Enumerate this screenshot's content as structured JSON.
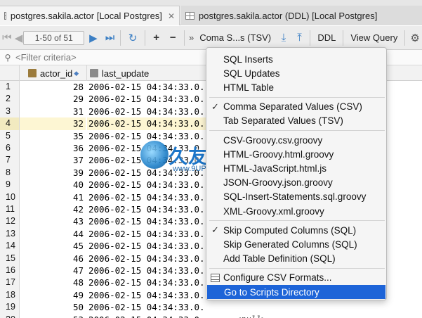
{
  "tabs": [
    {
      "label": "postgres.sakila.actor [Local Postgres]",
      "active": true
    },
    {
      "label": "postgres.sakila.actor (DDL) [Local Postgres]",
      "active": false
    }
  ],
  "toolbar": {
    "pager": "1-50 of 51",
    "export_label": "Coma S...s (TSV)",
    "ddl_label": "DDL",
    "view_query_label": "View Query",
    "more_label": "»"
  },
  "filter": {
    "placeholder": "<Filter criteria>"
  },
  "grid": {
    "columns": [
      "actor_id",
      "last_update"
    ],
    "rows": [
      {
        "num": "1",
        "id": "28",
        "upd": "2006-02-15 04:34:33.0..."
      },
      {
        "num": "2",
        "id": "29",
        "upd": "2006-02-15 04:34:33.0..."
      },
      {
        "num": "3",
        "id": "31",
        "upd": "2006-02-15 04:34:33.0..."
      },
      {
        "num": "4",
        "id": "32",
        "upd": "2006-02-15 04:34:33.0..."
      },
      {
        "num": "5",
        "id": "35",
        "upd": "2006-02-15 04:34:33.0..."
      },
      {
        "num": "6",
        "id": "36",
        "upd": "2006-02-15 04:34:33.0..."
      },
      {
        "num": "7",
        "id": "37",
        "upd": "2006-02-15 04:34:33.0..."
      },
      {
        "num": "8",
        "id": "39",
        "upd": "2006-02-15 04:34:33.0..."
      },
      {
        "num": "9",
        "id": "40",
        "upd": "2006-02-15 04:34:33.0..."
      },
      {
        "num": "10",
        "id": "41",
        "upd": "2006-02-15 04:34:33.0..."
      },
      {
        "num": "11",
        "id": "42",
        "upd": "2006-02-15 04:34:33.0..."
      },
      {
        "num": "12",
        "id": "43",
        "upd": "2006-02-15 04:34:33.0..."
      },
      {
        "num": "13",
        "id": "44",
        "upd": "2006-02-15 04:34:33.0..."
      },
      {
        "num": "14",
        "id": "45",
        "upd": "2006-02-15 04:34:33.0..."
      },
      {
        "num": "15",
        "id": "46",
        "upd": "2006-02-15 04:34:33.0..."
      },
      {
        "num": "16",
        "id": "47",
        "upd": "2006-02-15 04:34:33.0..."
      },
      {
        "num": "17",
        "id": "48",
        "upd": "2006-02-15 04:34:33.0..."
      },
      {
        "num": "18",
        "id": "49",
        "upd": "2006-02-15 04:34:33.0..."
      },
      {
        "num": "19",
        "id": "50",
        "upd": "2006-02-15 04:34:33.0..."
      },
      {
        "num": "20",
        "id": "53",
        "upd": "2006-02-15 04:34:33.0..."
      }
    ],
    "null_text": "<null>"
  },
  "menu": {
    "items": [
      {
        "label": "SQL Inserts",
        "checked": false
      },
      {
        "label": "SQL Updates",
        "checked": false
      },
      {
        "label": "HTML Table",
        "checked": false
      },
      {
        "separator": true
      },
      {
        "label": "Comma Separated Values (CSV)",
        "checked": true
      },
      {
        "label": "Tab Separated Values (TSV)",
        "checked": false
      },
      {
        "separator": true
      },
      {
        "label": "CSV-Groovy.csv.groovy",
        "checked": false
      },
      {
        "label": "HTML-Groovy.html.groovy",
        "checked": false
      },
      {
        "label": "HTML-JavaScript.html.js",
        "checked": false
      },
      {
        "label": "JSON-Groovy.json.groovy",
        "checked": false
      },
      {
        "label": "SQL-Insert-Statements.sql.groovy",
        "checked": false
      },
      {
        "label": "XML-Groovy.xml.groovy",
        "checked": false
      },
      {
        "separator": true
      },
      {
        "label": "Skip Computed Columns (SQL)",
        "checked": true
      },
      {
        "label": "Skip Generated Columns (SQL)",
        "checked": false
      },
      {
        "label": "Add Table Definition (SQL)",
        "checked": false
      },
      {
        "separator": true
      },
      {
        "label": "Configure CSV Formats...",
        "checked": false,
        "icon": "configure-icon"
      },
      {
        "label": "Go to Scripts Directory",
        "checked": false,
        "selected": true
      }
    ]
  },
  "watermark": {
    "title": "久友下载站",
    "url": "www.9UPK.Com"
  },
  "colors": {
    "selection": "#1d64d8",
    "highlight_row": "#fdf6d3",
    "accent": "#3c7fc4"
  }
}
